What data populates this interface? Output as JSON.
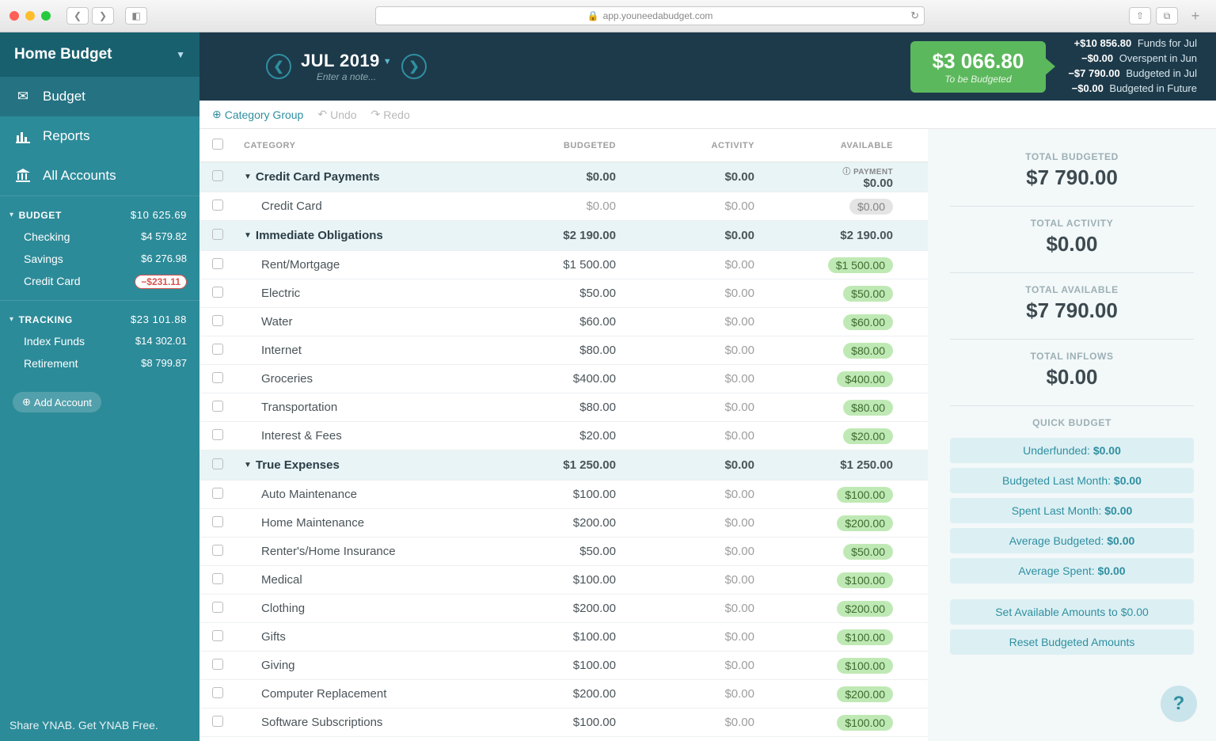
{
  "browser": {
    "url": "app.youneedabudget.com"
  },
  "sidebar": {
    "budget_name": "Home Budget",
    "nav": {
      "budget": "Budget",
      "reports": "Reports",
      "all_accounts": "All Accounts"
    },
    "sections": [
      {
        "label": "BUDGET",
        "total": "$10 625.69",
        "accounts": [
          {
            "name": "Checking",
            "amt": "$4 579.82"
          },
          {
            "name": "Savings",
            "amt": "$6 276.98"
          },
          {
            "name": "Credit Card",
            "amt": "−$231.11",
            "neg": true
          }
        ]
      },
      {
        "label": "TRACKING",
        "total": "$23 101.88",
        "accounts": [
          {
            "name": "Index Funds",
            "amt": "$14 302.01"
          },
          {
            "name": "Retirement",
            "amt": "$8 799.87"
          }
        ]
      }
    ],
    "add_account": "Add Account",
    "footer": "Share YNAB. Get YNAB Free."
  },
  "header": {
    "month": "JUL 2019",
    "note_placeholder": "Enter a note...",
    "tbb_amount": "$3 066.80",
    "tbb_label": "To be Budgeted",
    "age": [
      {
        "amt": "+$10 856.80",
        "lbl": "Funds for Jul"
      },
      {
        "amt": "−$0.00",
        "lbl": "Overspent in Jun"
      },
      {
        "amt": "−$7 790.00",
        "lbl": "Budgeted in Jul"
      },
      {
        "amt": "−$0.00",
        "lbl": "Budgeted in Future"
      }
    ]
  },
  "toolbar": {
    "add_group": "Category Group",
    "undo": "Undo",
    "redo": "Redo"
  },
  "columns": {
    "category": "CATEGORY",
    "budgeted": "BUDGETED",
    "activity": "ACTIVITY",
    "available": "AVAILABLE"
  },
  "groups": [
    {
      "name": "Credit Card Payments",
      "budgeted": "$0.00",
      "activity": "$0.00",
      "available": "$0.00",
      "payment_label": "PAYMENT",
      "items": [
        {
          "name": "Credit Card",
          "budgeted": "$0.00",
          "activity": "$0.00",
          "available": "$0.00",
          "pill": "grey"
        }
      ]
    },
    {
      "name": "Immediate Obligations",
      "budgeted": "$2 190.00",
      "activity": "$0.00",
      "available": "$2 190.00",
      "items": [
        {
          "name": "Rent/Mortgage",
          "budgeted": "$1 500.00",
          "activity": "$0.00",
          "available": "$1 500.00",
          "pill": "green"
        },
        {
          "name": "Electric",
          "budgeted": "$50.00",
          "activity": "$0.00",
          "available": "$50.00",
          "pill": "green"
        },
        {
          "name": "Water",
          "budgeted": "$60.00",
          "activity": "$0.00",
          "available": "$60.00",
          "pill": "green"
        },
        {
          "name": "Internet",
          "budgeted": "$80.00",
          "activity": "$0.00",
          "available": "$80.00",
          "pill": "green"
        },
        {
          "name": "Groceries",
          "budgeted": "$400.00",
          "activity": "$0.00",
          "available": "$400.00",
          "pill": "green"
        },
        {
          "name": "Transportation",
          "budgeted": "$80.00",
          "activity": "$0.00",
          "available": "$80.00",
          "pill": "green"
        },
        {
          "name": "Interest & Fees",
          "budgeted": "$20.00",
          "activity": "$0.00",
          "available": "$20.00",
          "pill": "green"
        }
      ]
    },
    {
      "name": "True Expenses",
      "budgeted": "$1 250.00",
      "activity": "$0.00",
      "available": "$1 250.00",
      "items": [
        {
          "name": "Auto Maintenance",
          "budgeted": "$100.00",
          "activity": "$0.00",
          "available": "$100.00",
          "pill": "green"
        },
        {
          "name": "Home Maintenance",
          "budgeted": "$200.00",
          "activity": "$0.00",
          "available": "$200.00",
          "pill": "green"
        },
        {
          "name": "Renter's/Home Insurance",
          "budgeted": "$50.00",
          "activity": "$0.00",
          "available": "$50.00",
          "pill": "green"
        },
        {
          "name": "Medical",
          "budgeted": "$100.00",
          "activity": "$0.00",
          "available": "$100.00",
          "pill": "green"
        },
        {
          "name": "Clothing",
          "budgeted": "$200.00",
          "activity": "$0.00",
          "available": "$200.00",
          "pill": "green"
        },
        {
          "name": "Gifts",
          "budgeted": "$100.00",
          "activity": "$0.00",
          "available": "$100.00",
          "pill": "green"
        },
        {
          "name": "Giving",
          "budgeted": "$100.00",
          "activity": "$0.00",
          "available": "$100.00",
          "pill": "green"
        },
        {
          "name": "Computer Replacement",
          "budgeted": "$200.00",
          "activity": "$0.00",
          "available": "$200.00",
          "pill": "green"
        },
        {
          "name": "Software Subscriptions",
          "budgeted": "$100.00",
          "activity": "$0.00",
          "available": "$100.00",
          "pill": "green"
        }
      ]
    }
  ],
  "inspector": {
    "stats": [
      {
        "lbl": "TOTAL BUDGETED",
        "amt": "$7 790.00"
      },
      {
        "lbl": "TOTAL ACTIVITY",
        "amt": "$0.00"
      },
      {
        "lbl": "TOTAL AVAILABLE",
        "amt": "$7 790.00"
      },
      {
        "lbl": "TOTAL INFLOWS",
        "amt": "$0.00"
      }
    ],
    "qb_title": "QUICK BUDGET",
    "qb": [
      {
        "pre": "Underfunded: ",
        "val": "$0.00"
      },
      {
        "pre": "Budgeted Last Month: ",
        "val": "$0.00"
      },
      {
        "pre": "Spent Last Month: ",
        "val": "$0.00"
      },
      {
        "pre": "Average Budgeted: ",
        "val": "$0.00"
      },
      {
        "pre": "Average Spent: ",
        "val": "$0.00"
      }
    ],
    "actions": [
      "Set Available Amounts to $0.00",
      "Reset Budgeted Amounts"
    ]
  }
}
